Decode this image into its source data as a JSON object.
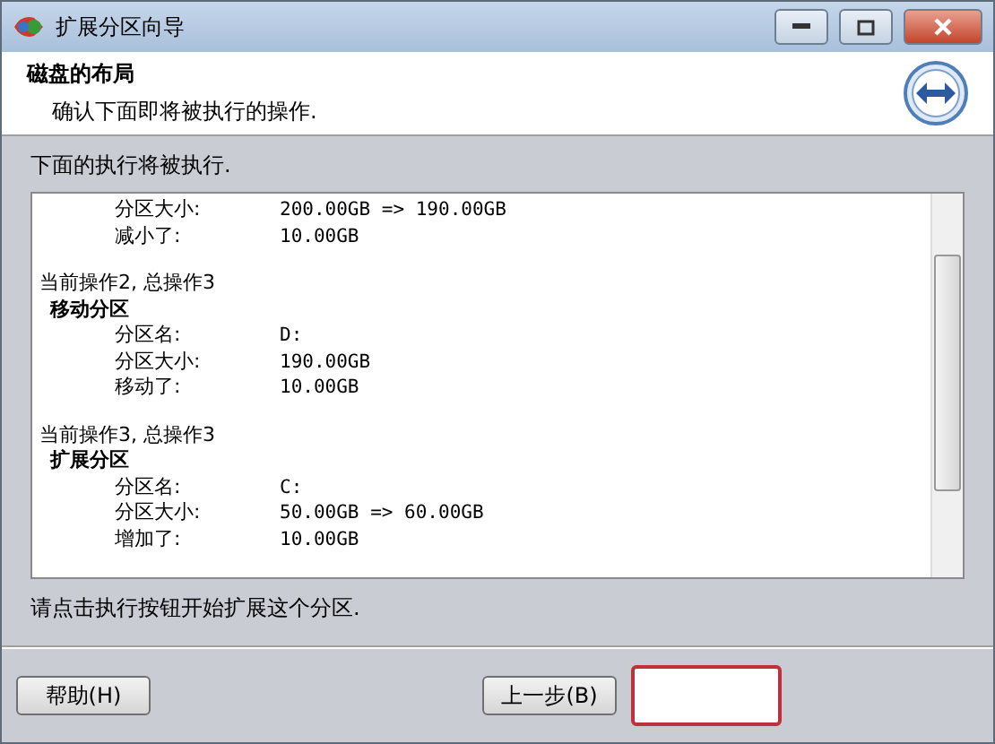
{
  "window": {
    "title": "扩展分区向导"
  },
  "header": {
    "title": "磁盘的布局",
    "subtitle": "确认下面即将被执行的操作."
  },
  "intro": "下面的执行将被执行.",
  "operations": [
    {
      "rows": [
        {
          "label": "分区大小:",
          "value": "200.00GB => 190.00GB"
        },
        {
          "label": "减小了:",
          "value": "10.00GB"
        }
      ]
    },
    {
      "progress": "当前操作2, 总操作3",
      "name": "移动分区",
      "rows": [
        {
          "label": "分区名:",
          "value": "D:"
        },
        {
          "label": "分区大小:",
          "value": "190.00GB"
        },
        {
          "label": "移动了:",
          "value": "10.00GB"
        }
      ]
    },
    {
      "progress": "当前操作3, 总操作3",
      "name": "扩展分区",
      "rows": [
        {
          "label": "分区名:",
          "value": "C:"
        },
        {
          "label": "分区大小:",
          "value": "50.00GB => 60.00GB"
        },
        {
          "label": "增加了:",
          "value": "10.00GB"
        }
      ]
    }
  ],
  "hint": "请点击执行按钮开始扩展这个分区.",
  "buttons": [
    {
      "label": "帮助(H)",
      "kind": "left"
    },
    {
      "label": "上一步(B)",
      "kind": "right"
    }
  ]
}
